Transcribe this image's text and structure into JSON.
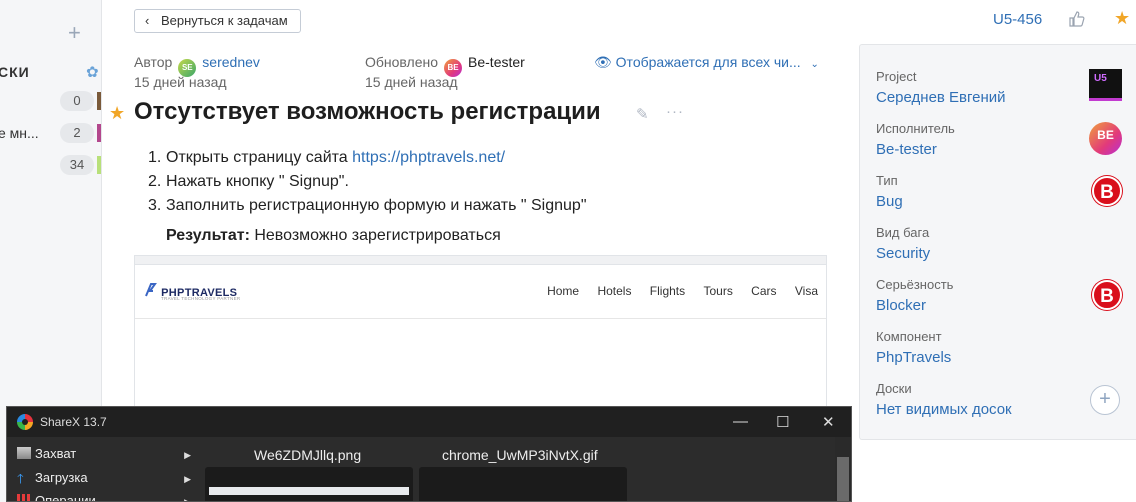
{
  "sidebar": {
    "section_label": "СКИ",
    "items": [
      {
        "label": "",
        "count": "0",
        "color": "#7a5a3a"
      },
      {
        "label": "е мн...",
        "count": "2",
        "color": "#b3478d"
      },
      {
        "label": "",
        "count": "34",
        "color": "#b8e07a"
      }
    ]
  },
  "header": {
    "back_label": "Вернуться к задачам",
    "issue_id": "U5-456"
  },
  "meta": {
    "author_label": "Автор",
    "author_initials": "SE",
    "author_name": "serednev",
    "author_time": "15 дней назад",
    "updated_label": "Обновлено",
    "updater_initials": "BE",
    "updater_name": "Be-tester",
    "updated_time": "15 дней назад",
    "visibility": "Отображается для всех чи..."
  },
  "issue": {
    "title": "Отсутствует возможность регистрации",
    "steps": [
      {
        "num": "1.",
        "text": "Открыть страницу сайта ",
        "link": "https://phptravels.net/"
      },
      {
        "num": "2.",
        "text": "Нажать кнопку \" Signup\".",
        "link": ""
      },
      {
        "num": "3.",
        "text": "Заполнить регистрационную формую и нажать \" Signup\"",
        "link": ""
      }
    ],
    "result_label": "Результат:",
    "result_text": " Невозможно зарегистрироваться"
  },
  "embed": {
    "logo_name": "PHPTRAVELS",
    "logo_tagline": "TRAVEL TECHNOLOGY PARTNER",
    "nav": [
      "Home",
      "Hotels",
      "Flights",
      "Tours",
      "Cars",
      "Visa"
    ]
  },
  "properties": [
    {
      "label": "Project",
      "value": "Середнев Евгений",
      "icon": "U5"
    },
    {
      "label": "Исполнитель",
      "value": "Be-tester",
      "icon": "BE"
    },
    {
      "label": "Тип",
      "value": "Bug",
      "icon": "B"
    },
    {
      "label": "Вид бага",
      "value": "Security",
      "icon": ""
    },
    {
      "label": "Серьёзность",
      "value": "Blocker",
      "icon": "B"
    },
    {
      "label": "Компонент",
      "value": "PhpTravels",
      "icon": ""
    },
    {
      "label": "Доски",
      "value": "Нет видимых досок",
      "icon": "+"
    }
  ],
  "sharex": {
    "title": "ShareX 13.7",
    "menu": [
      "Захват",
      "Загрузка",
      "Операции"
    ],
    "files": [
      "We6ZDMJllq.png",
      "chrome_UwMP3iNvtX.gif"
    ]
  },
  "colors": {
    "link": "#2f6fb5",
    "star": "#f1a628",
    "blocker_red": "#d90f1c",
    "panel_bg": "#f5f6f8"
  }
}
